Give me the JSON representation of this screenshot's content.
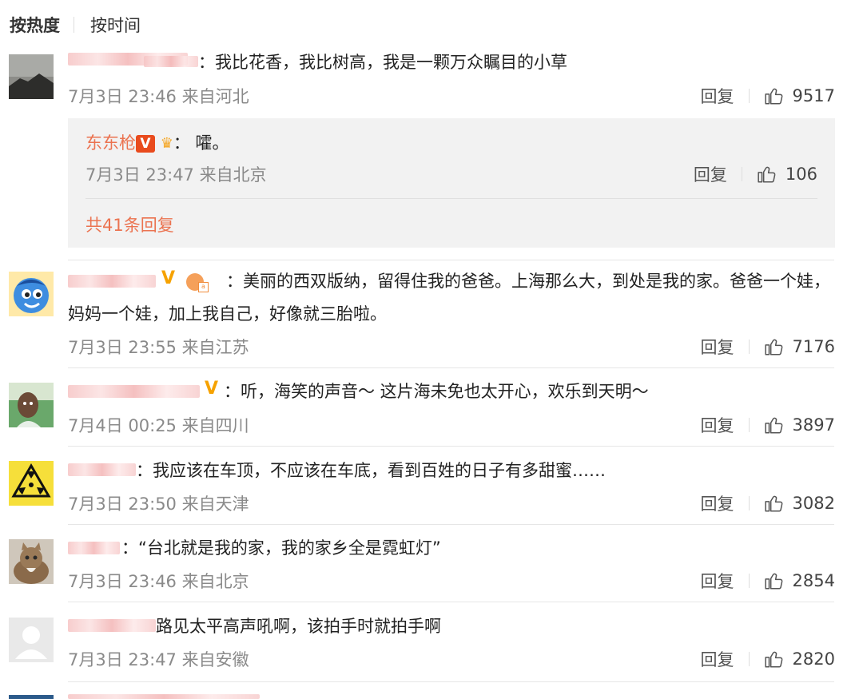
{
  "sort": {
    "hot": "按热度",
    "time": "按时间"
  },
  "comments": [
    {
      "text": "：我比花香，我比树高，我是一颗万众瞩目的小草",
      "date": "7月3日 23:46",
      "source": "来自河北",
      "reply": "回复",
      "likes": "9517"
    },
    {
      "text": "：美丽的西双版纳，留得住我的爸爸。上海那么大，到处是我的家。爸爸一个娃，妈妈一个娃，加上我自己，好像就三胎啦。",
      "date": "7月3日 23:55",
      "source": "来自江苏",
      "reply": "回复",
      "likes": "7176"
    },
    {
      "text": "：听，海笑的声音～ 这片海未免也太开心，欢乐到天明～",
      "date": "7月4日 00:25",
      "source": "来自四川",
      "reply": "回复",
      "likes": "3897"
    },
    {
      "text": "：我应该在车顶，不应该在车底，看到百姓的日子有多甜蜜……",
      "date": "7月3日 23:50",
      "source": "来自天津",
      "reply": "回复",
      "likes": "3082"
    },
    {
      "text": "：“台北就是我的家，我的家乡全是霓虹灯”",
      "date": "7月3日 23:46",
      "source": "来自北京",
      "reply": "回复",
      "likes": "2854"
    },
    {
      "text": "路见太平高声吼啊，该拍手时就拍手啊",
      "date": "7月3日 23:47",
      "source": "来自安徽",
      "reply": "回复",
      "likes": "2820"
    }
  ],
  "subreply": {
    "name": "东东枪",
    "text": "：  嚯。",
    "date": "7月3日 23:47",
    "source": "来自北京",
    "reply": "回复",
    "likes": "106",
    "more": "共41条回复"
  },
  "badges": {
    "v": "V"
  },
  "icons": {
    "like": "thumbs-up-icon",
    "avatar": "avatar-image"
  },
  "colors": {
    "link": "#eb7350",
    "meta": "#8a8a8a",
    "badge": "#f6a200"
  }
}
